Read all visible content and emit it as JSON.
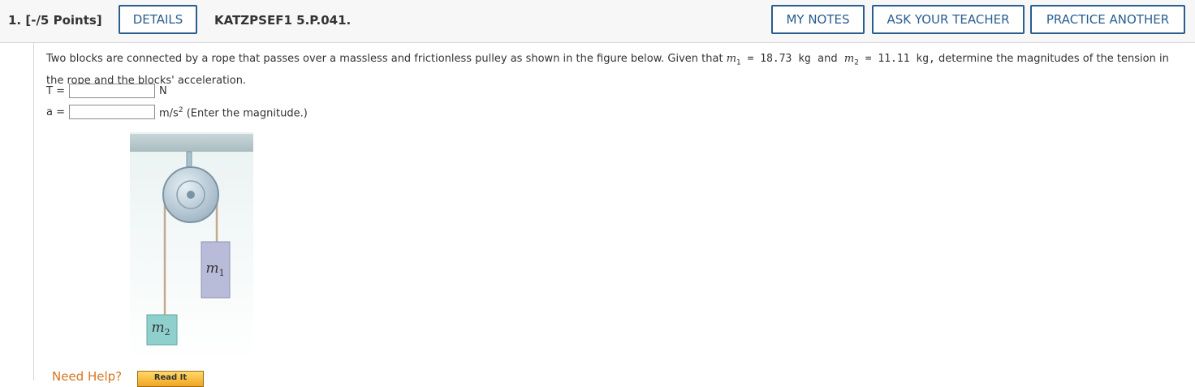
{
  "header": {
    "question_number": "1.",
    "points": "[-/5 Points]",
    "details_label": "DETAILS",
    "assignment_code": "KATZPSEF1 5.P.041.",
    "my_notes_label": "MY NOTES",
    "ask_teacher_label": "ASK YOUR TEACHER",
    "practice_another_label": "PRACTICE ANOTHER",
    "accent_color": "#2a5d8f"
  },
  "problem": {
    "text_part1": "Two blocks are connected by a rope that passes over a massless and frictionless pulley as shown in the figure below. Given that",
    "m1_symbol": "m",
    "m1_subscript": "1",
    "m1_value": " = 18.73 kg",
    "and_word": "and",
    "m2_symbol": "m",
    "m2_subscript": "2",
    "m2_value": " = 11.11 kg,",
    "text_part2": "determine the magnitudes of the tension in the rope and the blocks' acceleration."
  },
  "answers": {
    "tension_label": "T =",
    "tension_value": "",
    "tension_unit": "N",
    "accel_label": "a =",
    "accel_value": "",
    "accel_unit_base": "m/s",
    "accel_unit_exp": "2",
    "accel_note": "(Enter the magnitude.)"
  },
  "figure": {
    "block1_label": "m",
    "block1_sub": "1",
    "block2_label": "m",
    "block2_sub": "2",
    "block1_color": "#b9bcd9",
    "block2_color": "#8fd0cc"
  },
  "help": {
    "need_help_label": "Need Help?",
    "read_it_label": "Read It"
  }
}
